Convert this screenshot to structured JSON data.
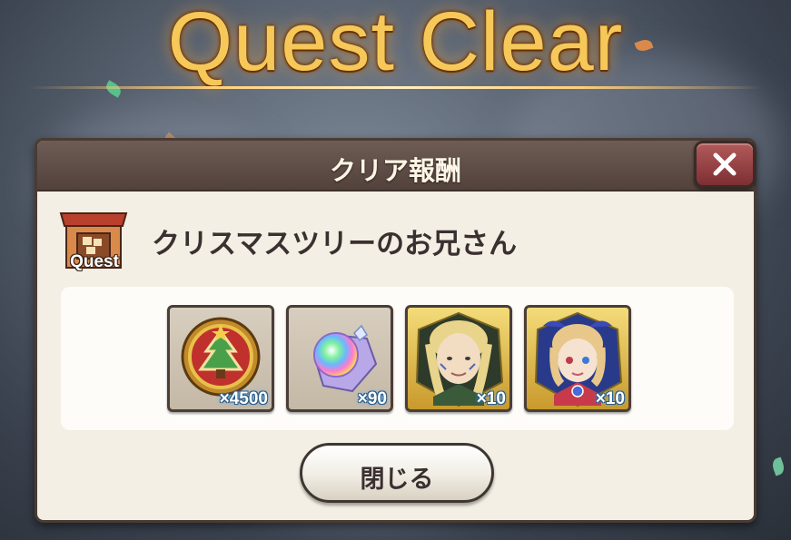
{
  "title": "Quest Clear",
  "dialog": {
    "header": "クリア報酬",
    "quest_icon_label": "Quest",
    "quest_name": "クリスマスツリーのお兄さん",
    "close_button_label": "閉じる"
  },
  "rewards": [
    {
      "icon": "christmas-tree-medal-icon",
      "count": "×4500"
    },
    {
      "icon": "rainbow-crystal-icon",
      "count": "×90"
    },
    {
      "icon": "elf-character-portrait",
      "count": "×10"
    },
    {
      "icon": "blonde-character-portrait",
      "count": "×10"
    }
  ],
  "colors": {
    "title": "#f6c85a",
    "header": "#5e4d46",
    "panel": "#f3efe4",
    "close_x_button": "#9a4446"
  }
}
